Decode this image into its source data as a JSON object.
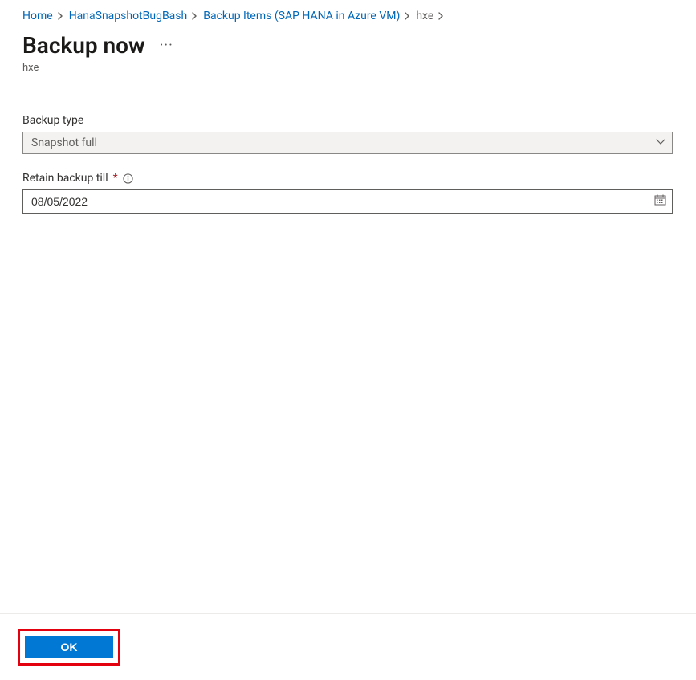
{
  "breadcrumb": {
    "items": [
      {
        "label": "Home"
      },
      {
        "label": "HanaSnapshotBugBash"
      },
      {
        "label": "Backup Items (SAP HANA in Azure VM)"
      },
      {
        "label": "hxe"
      }
    ]
  },
  "header": {
    "title": "Backup now",
    "subtitle": "hxe"
  },
  "form": {
    "backup_type": {
      "label": "Backup type",
      "value": "Snapshot full"
    },
    "retain": {
      "label": "Retain backup till",
      "value": "08/05/2022"
    }
  },
  "footer": {
    "ok_label": "OK"
  }
}
